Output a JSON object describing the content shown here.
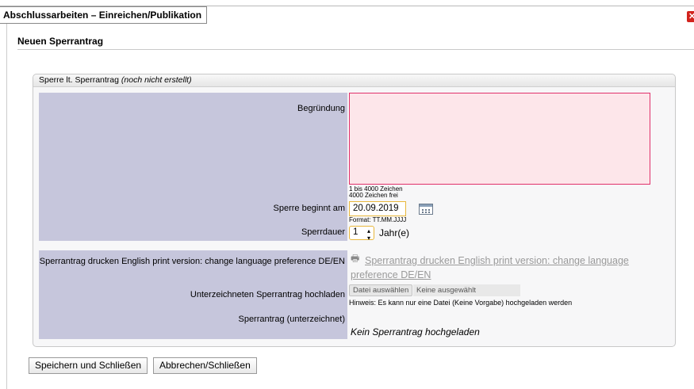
{
  "window": {
    "title": "Abschlussarbeiten – Einreichen/Publikation",
    "close_icon": "close-icon"
  },
  "page": {
    "subtitle": "Neuen Sperrantrag"
  },
  "fieldset": {
    "legend_prefix": "Sperre lt. Sperrantrag",
    "legend_status": "(noch nicht erstellt)"
  },
  "form": {
    "reason_label": "Begründung",
    "reason_value": "",
    "reason_hint_range": "1 bis 4000 Zeichen",
    "reason_hint_free": "4000 Zeichen frei",
    "start_label": "Sperre beginnt am",
    "start_value": "20.09.2019",
    "start_format": "Format: TT.MM.JJJJ",
    "duration_label": "Sperrdauer",
    "duration_value": "1",
    "duration_unit": "Jahr(e)",
    "print_label": "Sperrantrag drucken English print version: change language preference DE/EN",
    "print_link": "Sperrantrag drucken English print version: change language preference DE/EN",
    "upload_label": "Unterzeichneten Sperrantrag hochladen",
    "upload_button": "Datei auswählen",
    "upload_status": "Keine ausgewählt",
    "upload_hint": "Hinweis: Es kann nur eine Datei (Keine Vorgabe) hochgeladen werden",
    "signed_label": "Sperrantrag (unterzeichnet)",
    "signed_value": "Kein Sperrantrag hochgeladen"
  },
  "actions": {
    "save": "Speichern und Schließen",
    "cancel": "Abbrechen/Schließen"
  },
  "colors": {
    "label_bg": "#c6c6dc",
    "error_border": "#e0306a",
    "error_bg": "#fde6ea",
    "focus_border": "#e8b73c"
  }
}
